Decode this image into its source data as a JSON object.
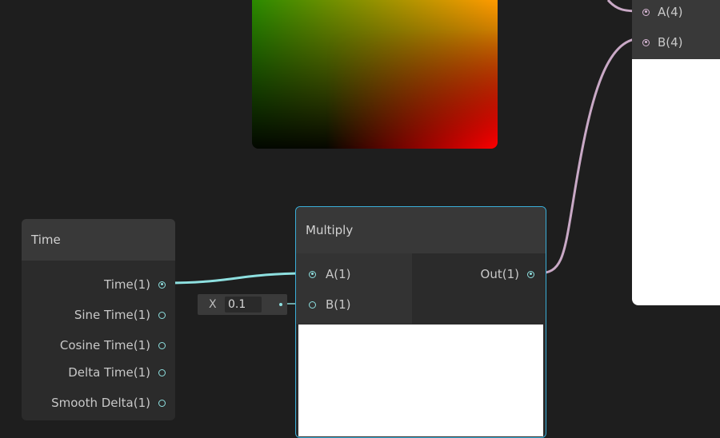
{
  "preview": {
    "colors": {
      "top_left": "#2a8a00",
      "top_right": "#ff9a00",
      "bottom_left": "#000000",
      "bottom_right": "#ff0000"
    }
  },
  "time_node": {
    "title": "Time",
    "outputs": [
      {
        "label": "Time(1)",
        "connected": true
      },
      {
        "label": "Sine Time(1)",
        "connected": false
      },
      {
        "label": "Cosine Time(1)",
        "connected": false
      },
      {
        "label": "Delta Time(1)",
        "connected": false
      },
      {
        "label": "Smooth Delta(1)",
        "connected": false
      }
    ]
  },
  "multiply_node": {
    "title": "Multiply",
    "inputs": [
      {
        "label": "A(1)"
      },
      {
        "label": "B(1)"
      }
    ],
    "output": {
      "label": "Out(1)"
    }
  },
  "x_field": {
    "label": "X",
    "value": "0.1"
  },
  "right_node": {
    "inputs": [
      {
        "label": "A(4)"
      },
      {
        "label": "B(4)"
      }
    ]
  },
  "colors": {
    "background": "#1e1e1e",
    "selection_border": "#3aaed8",
    "port_cyan": "#8ee0e0",
    "port_pink": "#d9b8d6"
  }
}
